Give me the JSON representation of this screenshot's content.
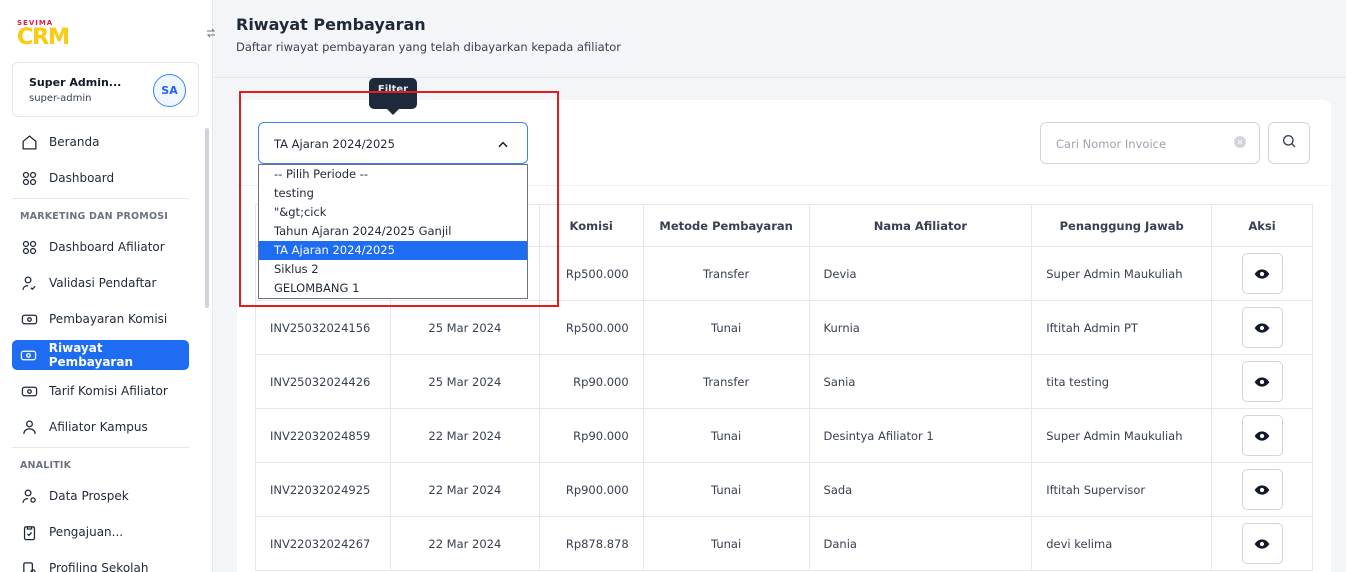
{
  "brand": {
    "top": "SEVIMA",
    "name": "CRM"
  },
  "user": {
    "name": "Super Admin...",
    "role": "super-admin",
    "initials": "SA"
  },
  "nav": {
    "beranda": "Beranda",
    "dashboard": "Dashboard",
    "section_marketing": "MARKETING DAN PROMOSI",
    "dashboard_afiliator": "Dashboard Afiliator",
    "validasi": "Validasi Pendaftar",
    "pembayaran": "Pembayaran Komisi",
    "riwayat": "Riwayat Pembayaran",
    "tarif": "Tarif Komisi Afiliator",
    "kampus": "Afiliator Kampus",
    "section_analitik": "ANALITIK",
    "prospek": "Data Prospek",
    "pengajuan": "Pengajuan...",
    "profiling": "Profiling Sekolah"
  },
  "header": {
    "title": "Riwayat Pembayaran",
    "subtitle": "Daftar riwayat pembayaran yang telah dibayarkan kepada afiliator"
  },
  "filter": {
    "tooltip": "Filter",
    "selected": "TA Ajaran 2024/2025",
    "options": [
      "-- Pilih Periode --",
      "testing",
      "\"&gt;cick",
      "Tahun Ajaran 2024/2025 Ganjil",
      "TA Ajaran 2024/2025",
      "Siklus 2",
      "GELOMBANG 1"
    ]
  },
  "search": {
    "placeholder": "Cari Nomor Invoice"
  },
  "table": {
    "headers": [
      "",
      "",
      "Komisi",
      "Metode Pembayaran",
      "Nama Afiliator",
      "Penanggung Jawab",
      "Aksi"
    ],
    "rows": [
      {
        "invoice": "",
        "date": "",
        "komisi": "Rp500.000",
        "metode": "Transfer",
        "nama": "Devia",
        "pj": "Super Admin Maukuliah"
      },
      {
        "invoice": "INV25032024156",
        "date": "25 Mar 2024",
        "komisi": "Rp500.000",
        "metode": "Tunai",
        "nama": "Kurnia",
        "pj": "Iftitah Admin PT"
      },
      {
        "invoice": "INV25032024426",
        "date": "25 Mar 2024",
        "komisi": "Rp90.000",
        "metode": "Transfer",
        "nama": "Sania",
        "pj": "tita testing"
      },
      {
        "invoice": "INV22032024859",
        "date": "22 Mar 2024",
        "komisi": "Rp90.000",
        "metode": "Tunai",
        "nama": "Desintya Afiliator 1",
        "pj": "Super Admin Maukuliah"
      },
      {
        "invoice": "INV22032024925",
        "date": "22 Mar 2024",
        "komisi": "Rp900.000",
        "metode": "Tunai",
        "nama": "Sada",
        "pj": "Iftitah Supervisor"
      },
      {
        "invoice": "INV22032024267",
        "date": "22 Mar 2024",
        "komisi": "Rp878.878",
        "metode": "Tunai",
        "nama": "Dania",
        "pj": "devi kelima"
      }
    ]
  },
  "colors": {
    "primary": "#1d6cf2",
    "highlight": "#e11d1d",
    "tooltip": "#1e293b"
  }
}
